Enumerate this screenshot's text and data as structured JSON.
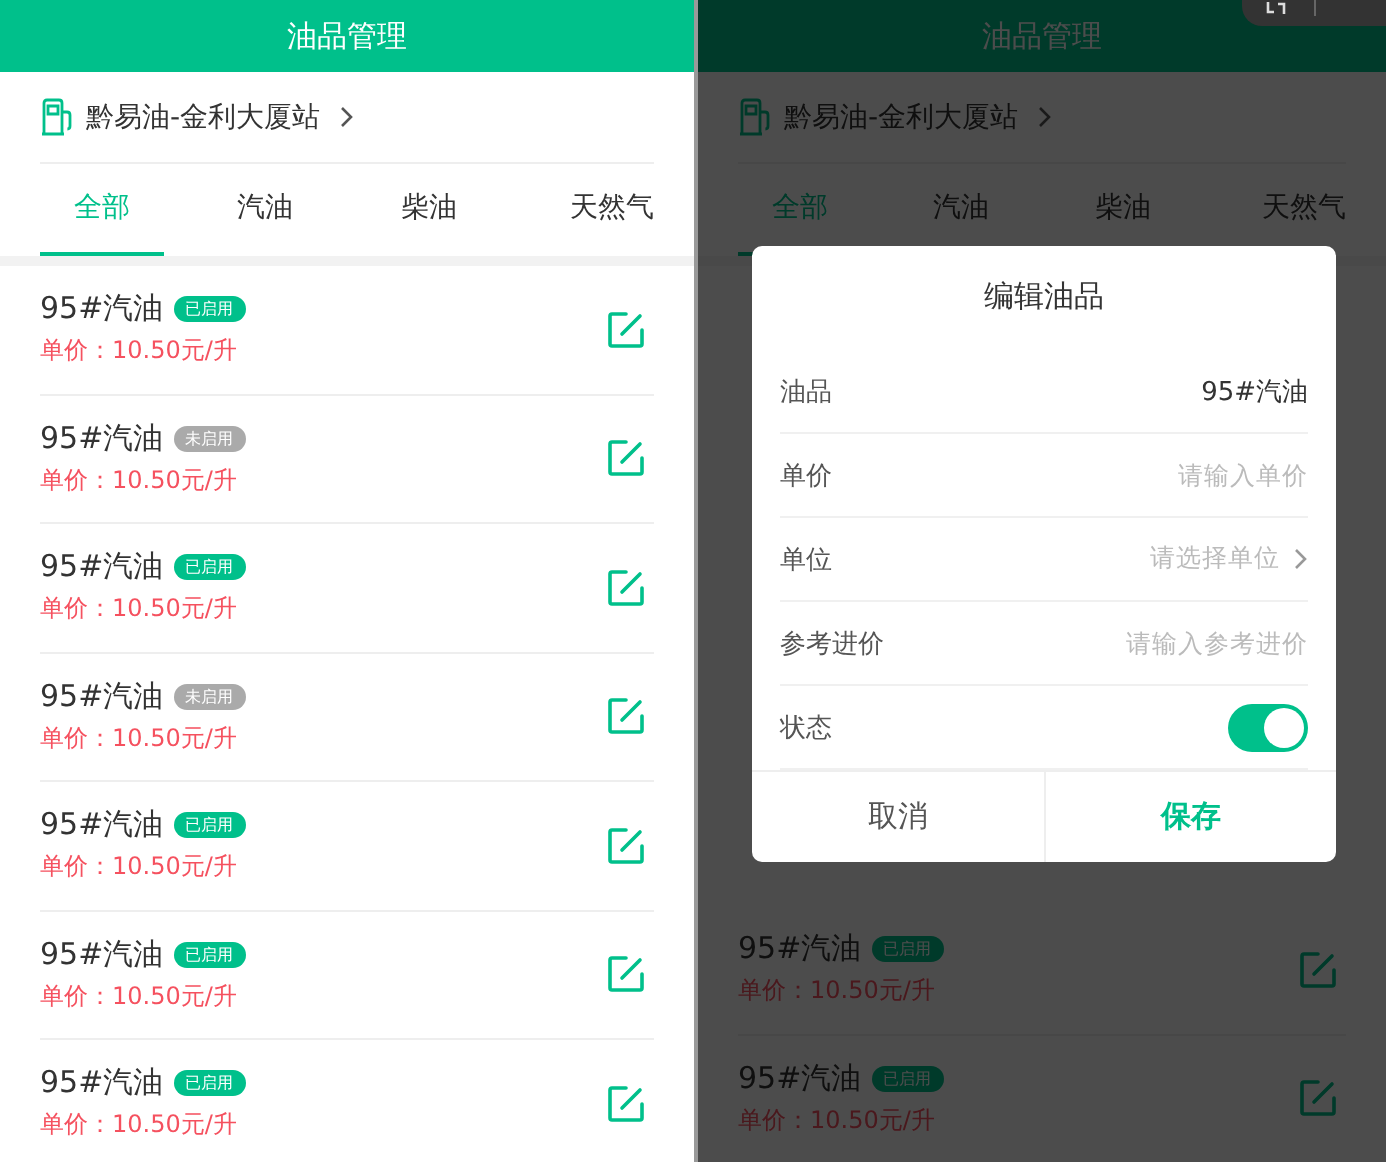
{
  "screens": [
    {
      "title": "油品管理",
      "station": "黔易油-金利大厦站",
      "tabs": [
        {
          "label": "全部",
          "selected": true
        },
        {
          "label": "汽油",
          "selected": false
        },
        {
          "label": "柴油",
          "selected": false
        },
        {
          "label": "天然气",
          "selected": false
        }
      ],
      "items": [
        {
          "name": "95#汽油",
          "status": "已启用",
          "enabled": true,
          "price": "单价：10.50元/升"
        },
        {
          "name": "95#汽油",
          "status": "未启用",
          "enabled": false,
          "price": "单价：10.50元/升"
        },
        {
          "name": "95#汽油",
          "status": "已启用",
          "enabled": true,
          "price": "单价：10.50元/升"
        },
        {
          "name": "95#汽油",
          "status": "未启用",
          "enabled": false,
          "price": "单价：10.50元/升"
        },
        {
          "name": "95#汽油",
          "status": "已启用",
          "enabled": true,
          "price": "单价：10.50元/升"
        },
        {
          "name": "95#汽油",
          "status": "已启用",
          "enabled": true,
          "price": "单价：10.50元/升"
        },
        {
          "name": "95#汽油",
          "status": "已启用",
          "enabled": true,
          "price": "单价：10.50元/升"
        }
      ]
    },
    {
      "title": "油品管理",
      "station": "黔易油-金利大厦站",
      "tabs": [
        {
          "label": "全部",
          "selected": true
        },
        {
          "label": "汽油",
          "selected": false
        },
        {
          "label": "柴油",
          "selected": false
        },
        {
          "label": "天然气",
          "selected": false
        }
      ],
      "items": [
        {
          "name": "95#汽油",
          "status": "已启用",
          "enabled": true,
          "price": "单价：10.50元/升"
        },
        {
          "name": "95#汽油",
          "status": "已启用",
          "enabled": true,
          "price": "单价：10.50元/升"
        }
      ],
      "dialog": {
        "title": "编辑油品",
        "fields": [
          {
            "kind": "value",
            "label": "油品",
            "value": "95#汽油"
          },
          {
            "kind": "input",
            "label": "单价",
            "placeholder": "请输入单价"
          },
          {
            "kind": "select",
            "label": "单位",
            "placeholder": "请选择单位"
          },
          {
            "kind": "input",
            "label": "参考进价",
            "placeholder": "请输入参考进价"
          },
          {
            "kind": "toggle",
            "label": "状态",
            "on": true
          }
        ],
        "buttons": [
          {
            "kind": "cancel",
            "label": "取消"
          },
          {
            "kind": "save",
            "label": "保存"
          }
        ]
      }
    }
  ]
}
